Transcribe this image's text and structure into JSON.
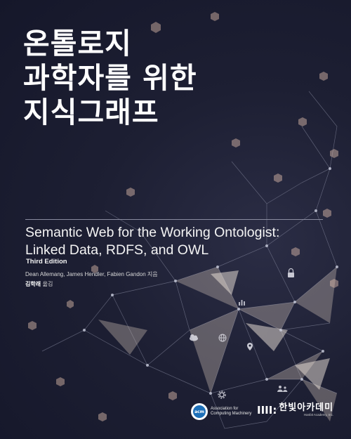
{
  "title_lines": [
    "온톨로지",
    "과학자를 위한",
    "지식그래프"
  ],
  "subtitle_lines": [
    "Semantic Web for the Working Ontologist:",
    "Linked Data, RDFS, and OWL"
  ],
  "edition": "Third Edition",
  "authors": "Dean Allemang, James Hendler, Fabien Gandon 지음",
  "translator_name": "김학래",
  "translator_role": "옮김",
  "acm": {
    "logo": "acm",
    "line1": "Association for",
    "line2": "Computing Machinery"
  },
  "publisher": {
    "mark": "IIII:",
    "name": "한빛아카데미",
    "tagline": "Hanbit Academy, Inc."
  },
  "colors": {
    "background": "#1a1c2e",
    "title": "#ffffff",
    "acm_blue": "#1d6fb8"
  },
  "icons": [
    "network-graph-illustration",
    "lock-icon",
    "location-pin-icon",
    "cloud-icon",
    "globe-icon",
    "users-icon",
    "gear-icon",
    "chart-icon"
  ]
}
